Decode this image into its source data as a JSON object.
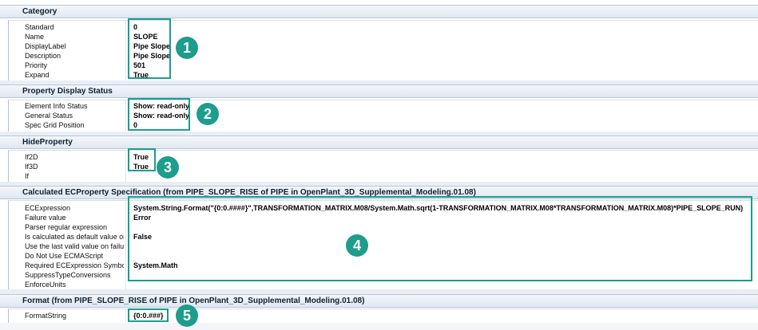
{
  "sections": [
    {
      "title": "Category",
      "rows": [
        {
          "key": "Standard",
          "value": "0"
        },
        {
          "key": "Name",
          "value": "SLOPE"
        },
        {
          "key": "DisplayLabel",
          "value": "Pipe Slope"
        },
        {
          "key": "Description",
          "value": "Pipe Slope"
        },
        {
          "key": "Priority",
          "value": "501"
        },
        {
          "key": "Expand",
          "value": "True"
        }
      ]
    },
    {
      "title": "Property Display Status",
      "rows": [
        {
          "key": "Element Info Status",
          "value": "Show: read-only"
        },
        {
          "key": "General Status",
          "value": "Show: read-only"
        },
        {
          "key": "Spec Grid Position",
          "value": "0"
        }
      ]
    },
    {
      "title": "HideProperty",
      "rows": [
        {
          "key": "If2D",
          "value": "True"
        },
        {
          "key": "If3D",
          "value": "True"
        },
        {
          "key": "If",
          "value": ""
        }
      ]
    },
    {
      "title": "Calculated ECProperty Specification (from PIPE_SLOPE_RISE of PIPE in OpenPlant_3D_Supplemental_Modeling.01.08)",
      "rows": [
        {
          "key": "ECExpression",
          "value": "System.String.Format(\"{0:0.####}\",TRANSFORMATION_MATRIX.M08/System.Math.sqrt(1-TRANSFORMATION_MATRIX.M08*TRANSFORMATION_MATRIX.M08)*PIPE_SLOPE_RUN)"
        },
        {
          "key": "Failure value",
          "value": "Error"
        },
        {
          "key": "Parser regular expression",
          "value": ""
        },
        {
          "key": "Is calculated as default value only",
          "value": "False"
        },
        {
          "key": "Use the last valid value on failure",
          "value": ""
        },
        {
          "key": "Do Not Use ECMAScript",
          "value": ""
        },
        {
          "key": "Required ECExpression SymbolSets",
          "value": "System.Math"
        },
        {
          "key": "SuppressTypeConversions",
          "value": ""
        },
        {
          "key": "EnforceUnits",
          "value": ""
        }
      ]
    },
    {
      "title": "Format (from PIPE_SLOPE_RISE of PIPE in OpenPlant_3D_Supplemental_Modeling.01.08)",
      "rows": [
        {
          "key": "FormatString",
          "value": "{0:0.###}"
        }
      ]
    }
  ],
  "callouts": [
    "1",
    "2",
    "3",
    "4",
    "5"
  ],
  "colors": {
    "accent": "#1e9c8c",
    "header_bg": "#dfe7f1"
  }
}
